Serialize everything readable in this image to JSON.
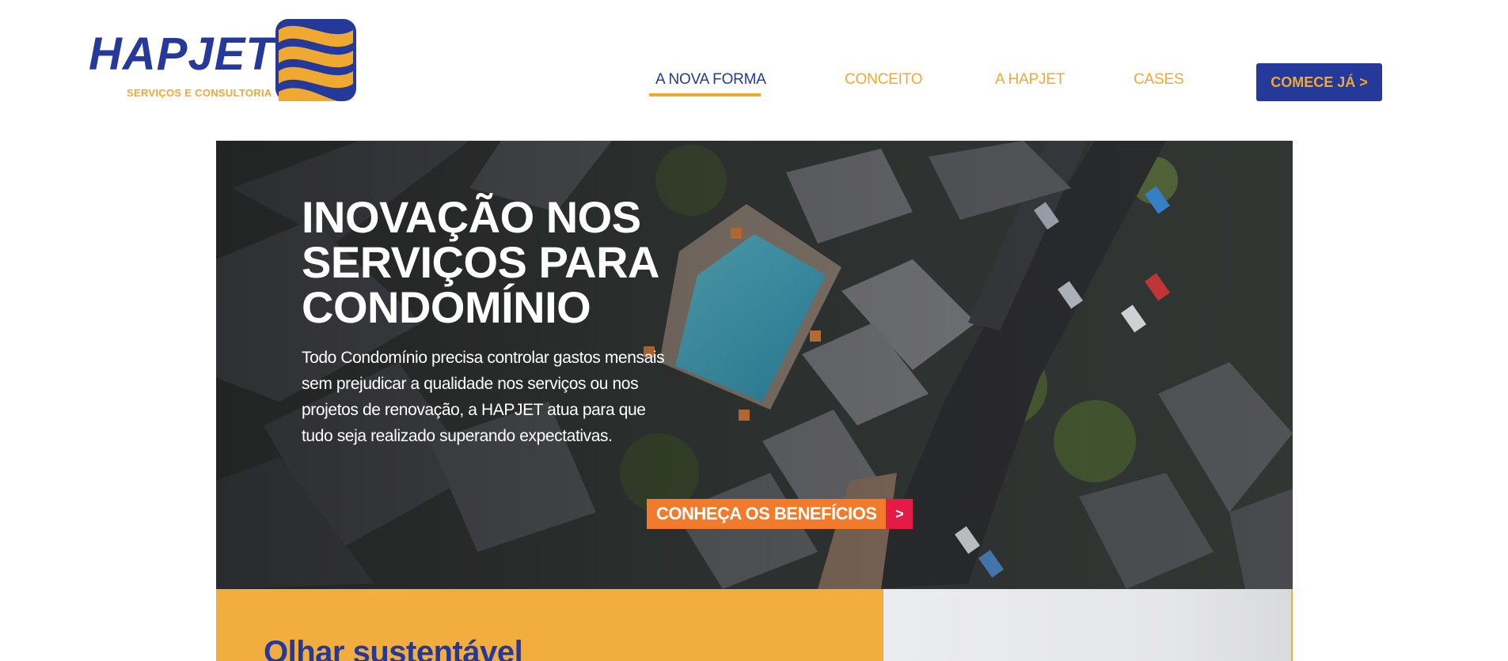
{
  "brand": {
    "name": "HAPJET",
    "tagline": "SERVIÇOS E CONSULTORIA",
    "colors": {
      "primary": "#25399a",
      "accent": "#f0a930",
      "cta_orange": "#f27a2b",
      "cta_red": "#e51b45"
    }
  },
  "nav": {
    "items": [
      {
        "label": "A NOVA FORMA",
        "active": true
      },
      {
        "label": "CONCEITO",
        "active": false
      },
      {
        "label": "A HAPJET",
        "active": false
      },
      {
        "label": "CASES",
        "active": false
      }
    ],
    "cta_label": "COMECE JÁ >"
  },
  "hero": {
    "title_lines": [
      "INOVAÇÃO NOS",
      "SERVIÇOS PARA",
      "CONDOMÍNIO"
    ],
    "text": "Todo Condomínio precisa controlar gastos mensais sem prejudicar a qualidade nos serviços ou nos projetos de renovação, a HAPJET atua para que tudo seja realizado superando expectativas.",
    "cta_label": "CONHEÇA OS BENEFÍCIOS",
    "cta_arrow": ">",
    "background_icon": "aerial-condominium-image"
  },
  "section": {
    "title": "Olhar sustentável"
  }
}
